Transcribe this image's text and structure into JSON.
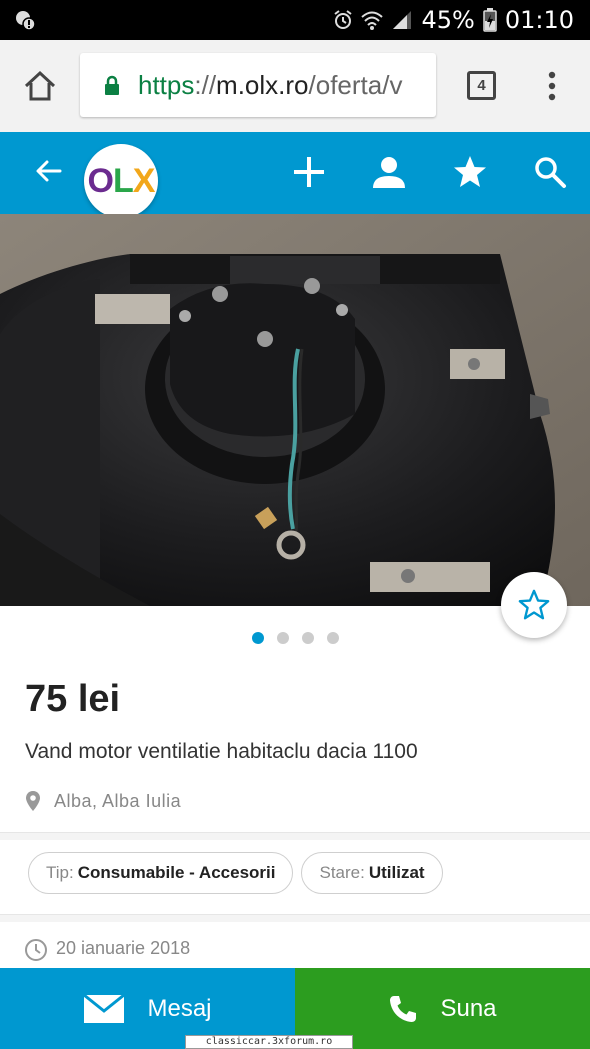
{
  "status_bar": {
    "battery": "45%",
    "time": "01:10"
  },
  "browser": {
    "url_scheme": "https",
    "url_sep": "://",
    "url_host": "m.olx.ro",
    "url_path": "/oferta/v",
    "tab_count": "4"
  },
  "header": {
    "logo_o": "O",
    "logo_l": "L",
    "logo_x": "X",
    "icons": [
      "back-arrow-icon",
      "plus-icon",
      "user-icon",
      "star-icon",
      "search-icon"
    ]
  },
  "gallery": {
    "image_count": 4,
    "active_index": 0
  },
  "listing": {
    "price": "75 lei",
    "title": "Vand motor ventilatie habitaclu dacia 1100",
    "location": "Alba, Alba Iulia",
    "params": [
      {
        "key": "Tip:",
        "value": "Consumabile - Accesorii"
      },
      {
        "key": "Stare:",
        "value": "Utilizat"
      }
    ],
    "date": "20 ianuarie 2018"
  },
  "actions": {
    "message_label": "Mesaj",
    "call_label": "Suna"
  },
  "watermark": "classiccar.3xforum.ro",
  "colors": {
    "brand_blue": "#0098d0",
    "call_green": "#2c9d1f",
    "secure_green": "#0b8043"
  }
}
